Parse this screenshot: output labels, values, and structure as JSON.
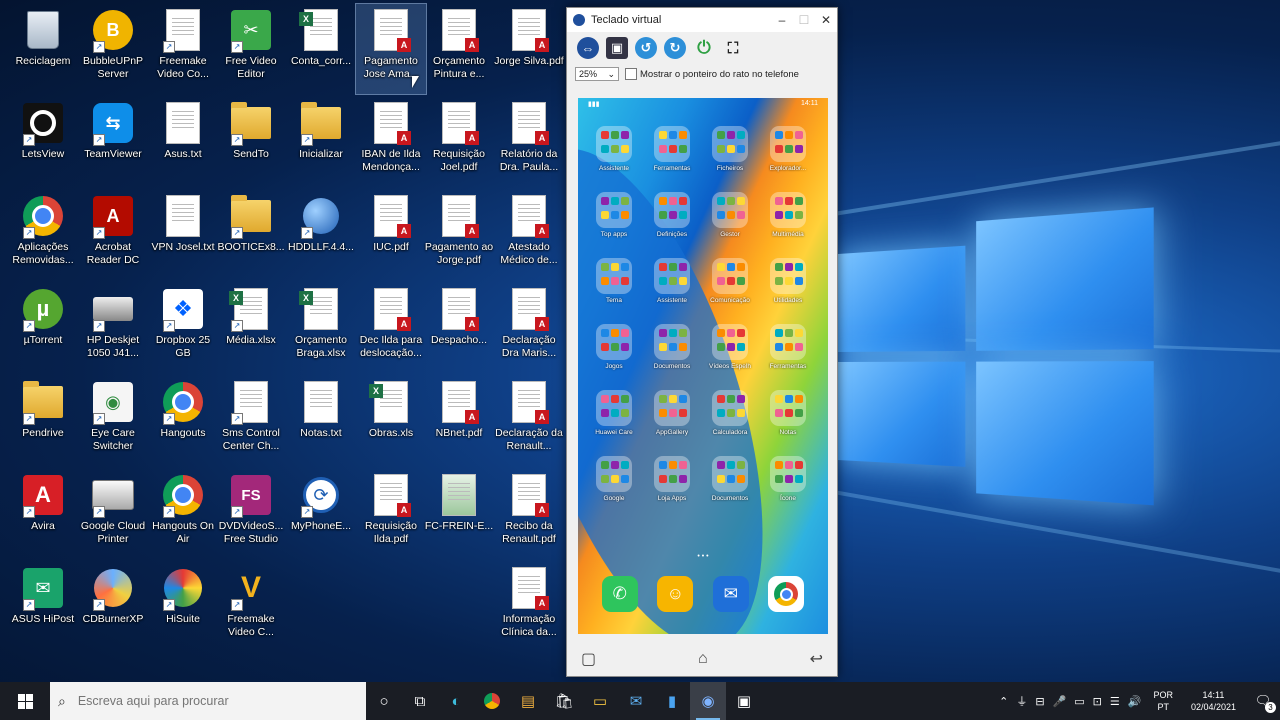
{
  "desktop": {
    "icons": [
      {
        "label": "Reciclagem"
      },
      {
        "label": "BubbleUPnP Server"
      },
      {
        "label": "Freemake Video Co..."
      },
      {
        "label": "Free Video Editor"
      },
      {
        "label": "Conta_corr..."
      },
      {
        "label": "Pagamento Jose Ama..."
      },
      {
        "label": "Orçamento Pintura e..."
      },
      {
        "label": "Jorge Silva.pdf"
      },
      {
        "label": "LetsView"
      },
      {
        "label": "TeamViewer"
      },
      {
        "label": "Asus.txt"
      },
      {
        "label": "SendTo"
      },
      {
        "label": "Inicializar"
      },
      {
        "label": "IBAN de Ilda Mendonça..."
      },
      {
        "label": "Requisição Joel.pdf"
      },
      {
        "label": "Relatório da Dra. Paula..."
      },
      {
        "label": "Aplicações Removidas..."
      },
      {
        "label": "Acrobat Reader DC"
      },
      {
        "label": "VPN Josel.txt"
      },
      {
        "label": "BOOTICEx8..."
      },
      {
        "label": "HDDLLF.4.4..."
      },
      {
        "label": "IUC.pdf"
      },
      {
        "label": "Pagamento ao Jorge.pdf"
      },
      {
        "label": "Atestado Médico de..."
      },
      {
        "label": "µTorrent"
      },
      {
        "label": "HP Deskjet 1050 J41..."
      },
      {
        "label": "Dropbox 25 GB"
      },
      {
        "label": "Média.xlsx"
      },
      {
        "label": "Orçamento Braga.xlsx"
      },
      {
        "label": "Dec Ilda para deslocação..."
      },
      {
        "label": "Despacho..."
      },
      {
        "label": "Declaração Dra Maris..."
      },
      {
        "label": "Pendrive"
      },
      {
        "label": "Eye Care Switcher"
      },
      {
        "label": "Hangouts"
      },
      {
        "label": "Sms Control Center Ch..."
      },
      {
        "label": "Notas.txt"
      },
      {
        "label": "Obras.xls"
      },
      {
        "label": "NBnet.pdf"
      },
      {
        "label": "Declaração da Renault..."
      },
      {
        "label": "Avira"
      },
      {
        "label": "Google Cloud Printer"
      },
      {
        "label": "Hangouts On Air"
      },
      {
        "label": "DVDVideoS... Free Studio"
      },
      {
        "label": "MyPhoneE..."
      },
      {
        "label": "Requisição Ilda.pdf"
      },
      {
        "label": "FC-FREIN-E..."
      },
      {
        "label": "Recibo da Renault.pdf"
      },
      {
        "label": "ASUS HiPost"
      },
      {
        "label": "CDBurnerXP"
      },
      {
        "label": "HiSuite"
      },
      {
        "label": "Freemake Video C..."
      },
      {
        "label": "Informação Clínica da..."
      }
    ]
  },
  "vk_window": {
    "title": "Teclado virtual",
    "zoom": "25%",
    "option_label": "Mostrar o ponteiro do rato no telefone",
    "phone_time": "14:11",
    "apps": [
      "Assistente",
      "Ferramentas",
      "Ficheiros",
      "Explorador...",
      "Top apps",
      "Definições",
      "Gestor",
      "Multimédia",
      "Tema",
      "Assistente",
      "Comunicação",
      "Utilidades",
      "Jogos",
      "Documentos",
      "Vídeos Espelh",
      "Ferramentas",
      "Huawei Care",
      "AppGallery",
      "Calculadora",
      "Notas",
      "Google",
      "Loja Apps",
      "Documentos",
      "Ícone"
    ],
    "home_dots": "• • •"
  },
  "taskbar": {
    "search_placeholder": "Escreva aqui para procurar",
    "lang_line1": "POR",
    "lang_line2": "PT",
    "time": "14:11",
    "date": "02/04/2021",
    "notification_count": "3"
  }
}
